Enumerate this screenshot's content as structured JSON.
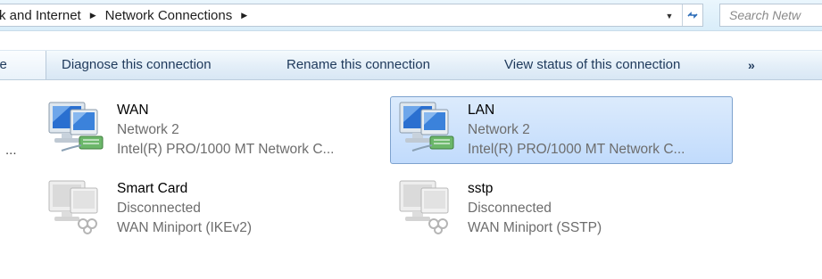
{
  "address_bar": {
    "breadcrumb_parent": "rk and Internet",
    "breadcrumb_current": "Network Connections",
    "search_placeholder": "Search Netw"
  },
  "command_bar": {
    "partial_label": "ce",
    "diagnose_label": "Diagnose this connection",
    "rename_label": "Rename this connection",
    "view_status_label": "View status of this connection",
    "more_label": "»"
  },
  "left_ellipsis": "...",
  "connections": [
    {
      "name": "WAN",
      "status": "Network  2",
      "device": "Intel(R) PRO/1000 MT Network C...",
      "connected": true,
      "selected": false
    },
    {
      "name": "LAN",
      "status": "Network  2",
      "device": "Intel(R) PRO/1000 MT Network C...",
      "connected": true,
      "selected": true
    },
    {
      "name": "Smart Card",
      "status": "Disconnected",
      "device": "WAN Miniport (IKEv2)",
      "connected": false,
      "selected": false
    },
    {
      "name": "sstp",
      "status": "Disconnected",
      "device": "WAN Miniport (SSTP)",
      "connected": false,
      "selected": false
    }
  ],
  "colors": {
    "accent_selected_bg": "#c1dbfc",
    "accent_selected_border": "#7da2ce",
    "command_text": "#1e395b",
    "secondary_text": "#6d6d6d"
  }
}
